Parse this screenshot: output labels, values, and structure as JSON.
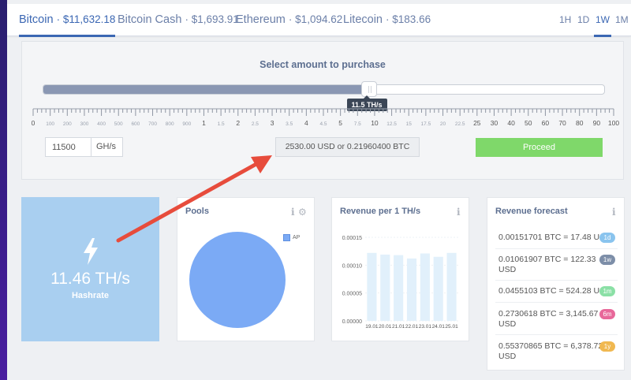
{
  "tabs": [
    {
      "name": "Bitcoin",
      "price": "$11,632.18",
      "active": true
    },
    {
      "name": "Bitcoin Cash",
      "price": "$1,693.91",
      "active": false
    },
    {
      "name": "Ethereum",
      "price": "$1,094.62",
      "active": false
    },
    {
      "name": "Litecoin",
      "price": "$183.66",
      "active": false
    }
  ],
  "tab_separator": "·",
  "ranges": [
    {
      "label": "1H",
      "active": false
    },
    {
      "label": "1D",
      "active": false
    },
    {
      "label": "1W",
      "active": true
    },
    {
      "label": "1M",
      "active": false
    }
  ],
  "purchase": {
    "title": "Select amount to purchase",
    "slider_fraction": 0.58,
    "tooltip": "11.5 TH/s",
    "ruler_labels": [
      "0",
      "100",
      "200",
      "300",
      "400",
      "500",
      "600",
      "700",
      "800",
      "900",
      "1",
      "1.5",
      "2",
      "2.5",
      "3",
      "3.5",
      "4",
      "4.5",
      "5",
      "7.5",
      "10",
      "12.5",
      "15",
      "17.5",
      "20",
      "22.5",
      "25",
      "30",
      "40",
      "50",
      "60",
      "70",
      "80",
      "90",
      "100"
    ],
    "input_value": "11500",
    "input_unit": "GH/s",
    "cost": "2530.00 USD or 0.21960400 BTC",
    "proceed_label": "Proceed"
  },
  "hashrate": {
    "value": "11.46 TH/s",
    "label": "Hashrate"
  },
  "pools": {
    "title": "Pools",
    "legend": "AP",
    "color": "#7baaf5"
  },
  "revenue_card": {
    "title": "Revenue per 1 TH/s"
  },
  "chart_data": {
    "type": "bar",
    "categories": [
      "19.01",
      "20.01",
      "21.01",
      "22.01",
      "23.01",
      "24.01",
      "25.01"
    ],
    "values": [
      0.000122,
      0.000119,
      0.000118,
      0.000112,
      0.000121,
      0.000115,
      0.000122
    ],
    "ylim": [
      0,
      0.00015
    ],
    "yticks": [
      "0.00015",
      "0.00010",
      "0.00005",
      "0.00000"
    ],
    "color": "#e1f0fb"
  },
  "forecast": {
    "title": "Revenue forecast",
    "rows": [
      {
        "text": "0.00151701 BTC = 17.48 USD",
        "badge": "1d",
        "color": "#8ac4ee"
      },
      {
        "text": "0.01061907 BTC = 122.33 USD",
        "badge": "1w",
        "color": "#7d8ea8"
      },
      {
        "text": "0.0455103 BTC = 524.28 USD",
        "badge": "1m",
        "color": "#8be0a6"
      },
      {
        "text": "0.2730618 BTC = 3,145.67 USD",
        "badge": "6m",
        "color": "#e8689a"
      },
      {
        "text": "0.55370865 BTC = 6,378.72 USD",
        "badge": "1y",
        "color": "#f0b850"
      }
    ]
  },
  "icons": {
    "info": "i",
    "gear": "⚙",
    "bolt": "lightning-bolt-icon"
  },
  "annotation_color": "#e74c3c"
}
